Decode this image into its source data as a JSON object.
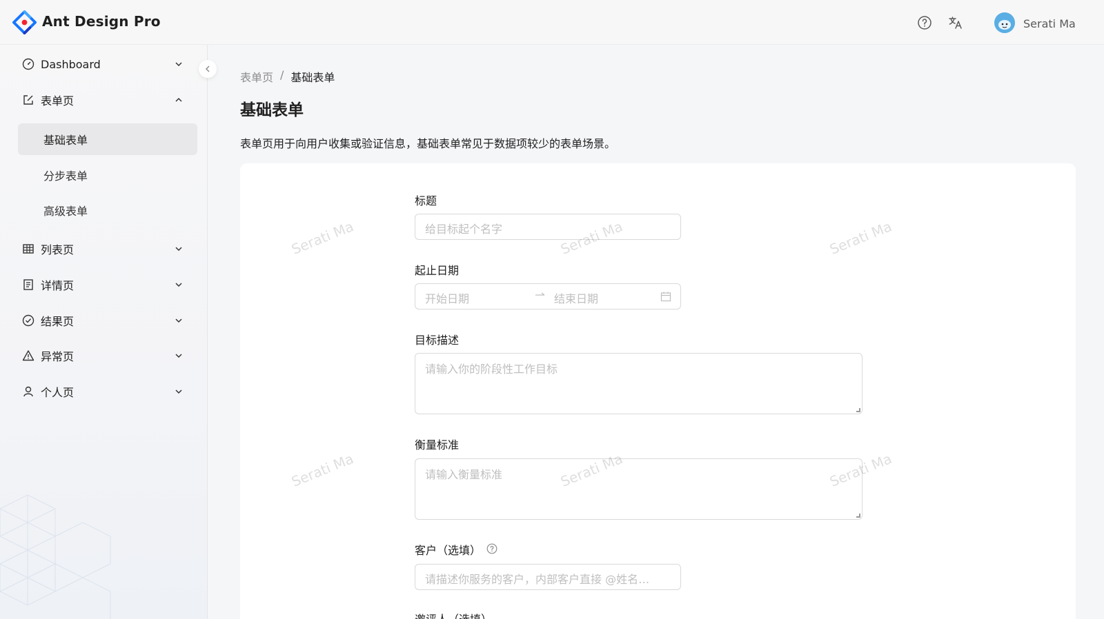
{
  "header": {
    "app_title": "Ant Design Pro",
    "user_name": "Serati Ma",
    "icons": {
      "help": "question-circle-icon",
      "language": "translate-icon"
    }
  },
  "sidebar": {
    "items": [
      {
        "label": "Dashboard",
        "icon": "dashboard-icon",
        "expanded": false
      },
      {
        "label": "表单页",
        "icon": "form-edit-icon",
        "expanded": true,
        "children": [
          {
            "label": "基础表单",
            "active": true
          },
          {
            "label": "分步表单",
            "active": false
          },
          {
            "label": "高级表单",
            "active": false
          }
        ]
      },
      {
        "label": "列表页",
        "icon": "table-icon",
        "expanded": false
      },
      {
        "label": "详情页",
        "icon": "profile-icon",
        "expanded": false
      },
      {
        "label": "结果页",
        "icon": "check-circle-icon",
        "expanded": false
      },
      {
        "label": "异常页",
        "icon": "warning-icon",
        "expanded": false
      },
      {
        "label": "个人页",
        "icon": "user-icon",
        "expanded": false
      }
    ]
  },
  "breadcrumb": {
    "parent": "表单页",
    "separator": "/",
    "current": "基础表单"
  },
  "page": {
    "title": "基础表单",
    "description": "表单页用于向用户收集或验证信息，基础表单常见于数据项较少的表单场景。"
  },
  "form": {
    "title_label": "标题",
    "title_placeholder": "给目标起个名字",
    "date_label": "起止日期",
    "date_start_placeholder": "开始日期",
    "date_end_placeholder": "结束日期",
    "goal_label": "目标描述",
    "goal_placeholder": "请输入你的阶段性工作目标",
    "standard_label": "衡量标准",
    "standard_placeholder": "请输入衡量标准",
    "client_label": "客户（选填）",
    "client_placeholder": "请描述你服务的客户，内部客户直接 @姓名…",
    "reviewer_label": "邀评人（选填）"
  },
  "watermark": "Serati Ma",
  "colors": {
    "accent": "#1677ff",
    "active_bg": "#e8e8ea"
  }
}
